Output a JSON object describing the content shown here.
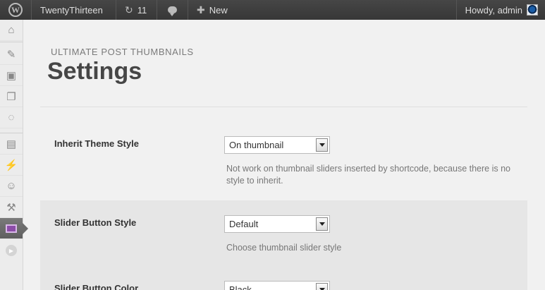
{
  "adminbar": {
    "logo_glyph": "W",
    "site_name": "TwentyThirteen",
    "updates_count": "11",
    "new_label": "New",
    "howdy": "Howdy, admin"
  },
  "menu": {
    "icons": [
      "dashboard-icon",
      "posts-pin-icon",
      "media-icon",
      "pages-icon",
      "comments-icon",
      "appearance-icon",
      "plugins-icon",
      "users-icon",
      "tools-icon",
      "ultimate-post-thumbnails-icon",
      "collapse-menu-icon"
    ]
  },
  "page": {
    "plugin_name": "ULTIMATE POST THUMBNAILS",
    "title": "Settings"
  },
  "settings": [
    {
      "label": "Inherit Theme Style",
      "value": "On thumbnail",
      "description": "Not work on thumbnail sliders inserted by shortcode, because there is no style to inherit."
    },
    {
      "label": "Slider Button Style",
      "value": "Default",
      "description": "Choose thumbnail slider style"
    },
    {
      "label": "Slider Button Color",
      "value": "Black",
      "description": ""
    }
  ]
}
